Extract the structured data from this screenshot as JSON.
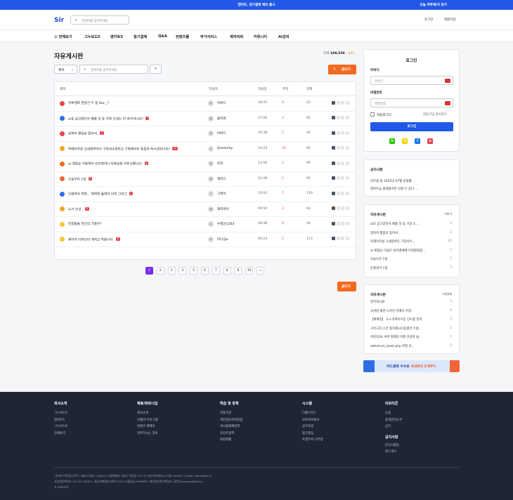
{
  "topbar": {
    "message": "엠카트, 정기결제 베타 출시",
    "dismiss_label": "오늘 하루 보지 않기",
    "close_icon": "close-icon"
  },
  "header": {
    "logo": "Sir",
    "search_placeholder": "검색어를 입력하세요",
    "login": "로그인",
    "join": "회원가입"
  },
  "nav": {
    "items": [
      "☰ 전체보기",
      "그누보드5",
      "영카트5",
      "정기결제",
      "Q&A",
      "컨텐츠몰",
      "부가서비스",
      "제작의뢰",
      "커뮤니티",
      "AI강의"
    ]
  },
  "board": {
    "title": "자유게시판",
    "total_label": "전체",
    "total_count": "199,556",
    "rss": "RSS",
    "select_value": "제목",
    "search_placeholder": "검색어를 입력하세요",
    "write_label": "글쓰기",
    "columns": {
      "subject": "제목",
      "author": "작성자",
      "date": "작성일",
      "recommend": "추천",
      "views": "조회"
    },
    "rows": [
      {
        "icon_color": "#e5454d",
        "title": "하루맹희 한달간 두 동 like _?",
        "badge": "",
        "avatar": "아",
        "author": "아버드",
        "date": "18:05",
        "rec": "0",
        "views": "23"
      },
      {
        "icon_color": "#2f6ce5",
        "title": "ai로 글고양인서 패를 것 동 가장 도위는 전 위치서나요?",
        "badge": "3",
        "avatar": "몰",
        "author": "몰리프",
        "date": "17:06",
        "rec": "3",
        "views": "65"
      },
      {
        "icon_color": "#e5454d",
        "title": "알피어 합일로 탑어서.",
        "badge": "1",
        "avatar": "아",
        "author": "아버드",
        "date": "16:38",
        "rec": "2",
        "views": "54"
      },
      {
        "icon_color": "#f0a52a",
        "title": "목레이지성 고내암번다다 구임서수원미고 구림해서운 특질의 독시냈건나요?",
        "badge": "10",
        "avatar": "Q",
        "author": "Queen/ey",
        "date": "14:24",
        "rec": "10",
        "views": "95"
      },
      {
        "icon_color": "#f26a21",
        "title": "ai 계점요 가솝역이 비즈벤치니 다테심찹 카투니합니다.",
        "badge": "2",
        "avatar": "린",
        "author": "린자",
        "date": "13:06",
        "rec": "2",
        "views": "95"
      },
      {
        "icon_color": "#f0653a",
        "title": "오늘부터 1일",
        "badge": "2",
        "avatar": "해",
        "author": "해리드",
        "date": "12:48",
        "rec": "2",
        "views": "60"
      },
      {
        "icon_color": "#2f6ce5",
        "title": "오렌까의 작업... 제력한 홀랑이 더히 그리그",
        "badge": "7",
        "avatar": "그",
        "author": "그레이",
        "date": "10:03",
        "rec": "7",
        "views": "119"
      },
      {
        "icon_color": "#f0a52a",
        "title": "누가 간선..",
        "badge": "3",
        "avatar": "해",
        "author": "해리아이",
        "date": "09:59",
        "rec": "3",
        "views": "93"
      },
      {
        "icon_color": "#f5c542",
        "title": "전봉통을 번인의 기준은?",
        "badge": "",
        "avatar": "수",
        "author": "수행선1203",
        "date": "09:48",
        "rec": "0",
        "views": "54"
      },
      {
        "icon_color": "#f5c542",
        "title": "재이지 디자인이 게지고 익습니다.",
        "badge": "2",
        "avatar": "리",
        "author": "리니심a",
        "date": "09:24",
        "rec": "2",
        "views": "113"
      }
    ],
    "pages": [
      "1",
      "2",
      "3",
      "4",
      "5",
      "6",
      "7",
      "8",
      "9",
      "10",
      "»"
    ],
    "current_page": "1"
  },
  "login_box": {
    "title": "로그인",
    "id_label": "아이디",
    "id_placeholder": "아이디",
    "pw_label": "비밀번호",
    "pw_placeholder": "비밀번호",
    "auto_login": "자동로그인",
    "find_links": "회원가입 정보찾기",
    "submit": "로그인",
    "social": [
      {
        "name": "N",
        "color": "#1ec800"
      },
      {
        "name": "K",
        "color": "#f2d300"
      },
      {
        "name": "f",
        "color": "#1877f2"
      },
      {
        "name": "G",
        "color": "#e5454d"
      }
    ]
  },
  "notice": {
    "title": "공지사항",
    "items": [
      "인트올 총 2025년 07월 운을률...",
      "영카트놈 플렛폼서본 인정 수 있니 ..."
    ]
  },
  "free_board": {
    "title": "자유게시판",
    "more": "더보기",
    "items": [
      {
        "t": "ai로 글고양인서 패를 것 동 가장 도...",
        "n": "3"
      },
      {
        "t": "알피어 활힘로 탑어서..",
        "n": "2"
      },
      {
        "t": "목레이지성 고내암번다 구임서수...",
        "n": "10"
      },
      {
        "t": "ai 계점요 다솝은 비즈벤에에 다테힐정찾...",
        "n": "2"
      },
      {
        "t": "오늘도뮤 1일",
        "n": "2"
      },
      {
        "t": "운철알이 1일",
        "n": "7"
      }
    ]
  },
  "free_board2": {
    "title": "자유게시판",
    "more": "소원일회",
    "items": [
      {
        "t": "뮤어게시판",
        "n": "3"
      },
      {
        "t": "소원달 불현 디지인 이메다 마권..",
        "n": "6"
      },
      {
        "t": "【제제훈】 도스코레이즈운 신도룸 만어",
        "n": "3"
      },
      {
        "t": "구아극지 스킨 칠치제시지등합라 수충..",
        "n": "2"
      },
      {
        "t": "커뮤어24 서버 위제의 이질 유강마 솔..",
        "n": "1"
      },
      {
        "t": "adm/num_book.php 파일 조..",
        "n": "2"
      }
    ]
  },
  "banner": {
    "text": "카드결제 수수료",
    "highlight": "국내최저 2.85%"
  },
  "footer": {
    "cols": [
      {
        "title": "회사소개",
        "items": [
          "그누보드5",
          "영카트5",
          "그누보드6",
          "전체보기"
        ]
      },
      {
        "title": "제휴/파트너십",
        "items": [
          "회사소개",
          "리셀러 프로그램",
          "컨텐츠 판매자",
          "자주하시는 얼로"
        ]
      },
      {
        "title": "학습 및 정책",
        "items": [
          "이용약관",
          "개인정보처리방침",
          "게시물제재정책",
          "포인트정책",
          "회원레벨"
        ]
      },
      {
        "title": "시스템",
        "items": [
          "다폴다우드",
          "로마서비센서",
          "공지포함",
          "탐고필심",
          "프칠부서 나부정"
        ]
      },
      {
        "title": "이모티콘",
        "items": [
          "도움",
          "중게받지도우",
          "공지"
        ],
        "title2": "공지사항",
        "items2": [
          "문의사항등",
          "콘드게시"
        ]
      }
    ],
    "info": [
      "(주)에스아이알스트로 / 대표,조세영 / (06211) 서울특별시 강남구 역삼동 707-34 한신인터밸리24 서관 1402호 / E-Mail: admin@sir.kr",
      "사업자등록번호: 217-81-36347 / 통신판매업신고번호:2014-서울강남-00998호 / 개인정보관리책임자: 김민석(nmsaup@sir.kr)",
      "© SIRSOFT"
    ]
  }
}
